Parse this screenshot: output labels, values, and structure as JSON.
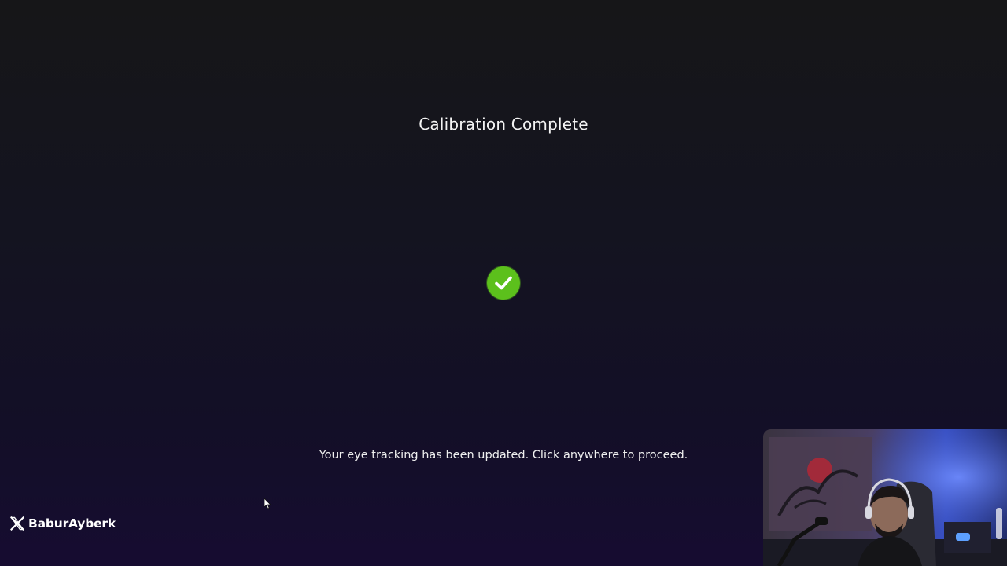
{
  "calibration": {
    "title": "Calibration Complete",
    "status_icon": "checkmark-circle-icon",
    "status_color": "#5cc01c",
    "message": "Your eye tracking has been updated. Click anywhere to proceed."
  },
  "overlay": {
    "social_icon": "x-logo-icon",
    "social_handle": "BaburAyberk"
  },
  "colors": {
    "background_top": "#161618",
    "background_bottom": "#160c31",
    "text": "#f2f2f2"
  }
}
